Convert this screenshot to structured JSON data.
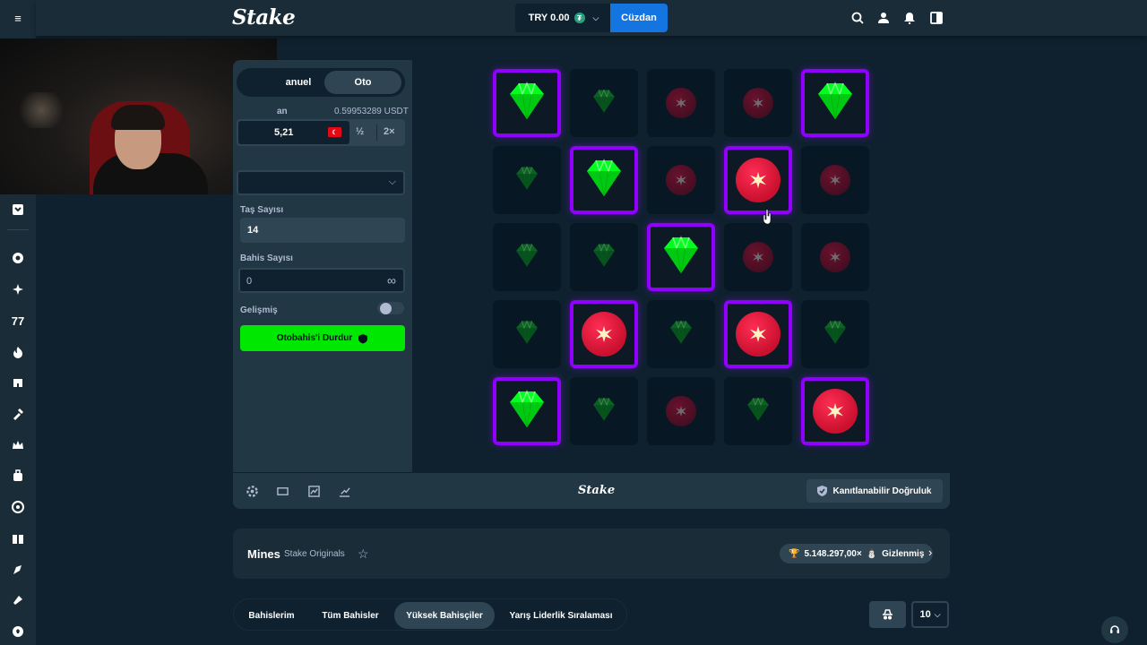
{
  "header": {
    "logo": "Stake",
    "balance": "TRY 0.00",
    "currency_icon": "tether-icon",
    "wallet_label": "Cüzdan"
  },
  "controls": {
    "tabs": [
      {
        "label": "Manuel",
        "visible": "anuel"
      },
      {
        "label": "Oto"
      }
    ],
    "bet_amount_label": "an",
    "bet_amount_usdt": "0.59953289 USDT",
    "bet_amount_value": "5,21",
    "half_label": "½",
    "double_label": "2×",
    "gems_label": "Taş Sayısı",
    "gems_value": "14",
    "bet_count_label": "Bahis Sayısı",
    "bet_count_value": "0",
    "advanced_label": "Gelişmiş",
    "advanced_on": false,
    "stop_button": "Otobahis'i Durdur"
  },
  "board": {
    "rows": 5,
    "cols": 5,
    "tiles": [
      "gem-sel",
      "gem",
      "mine",
      "mine",
      "gem-sel",
      "gem",
      "gem-sel",
      "mine",
      "mine-sel",
      "mine",
      "gem",
      "gem",
      "gem-sel",
      "mine",
      "mine",
      "gem",
      "mine-sel",
      "gem",
      "mine-sel",
      "gem",
      "gem-sel",
      "gem",
      "mine",
      "gem",
      "mine-sel"
    ],
    "colors": {
      "selected_border": "#9000ff",
      "gem": "#00e701",
      "mine": "#ff2d55"
    }
  },
  "game_toolbar": {
    "logo": "Stake",
    "fairness_button": "Kanıtlanabilir Doğruluk"
  },
  "game_info": {
    "title": "Mines",
    "subtitle": "Stake Originals",
    "record_value": "5.148.297,00×",
    "record_user": "Gizlenmiş"
  },
  "bets_tabs": [
    "Bahislerim",
    "Tüm Bahisler",
    "Yüksek Bahisçiler",
    "Yarış Liderlik Sıralaması"
  ],
  "bets_active_tab": 2,
  "rows_per_page": "10"
}
